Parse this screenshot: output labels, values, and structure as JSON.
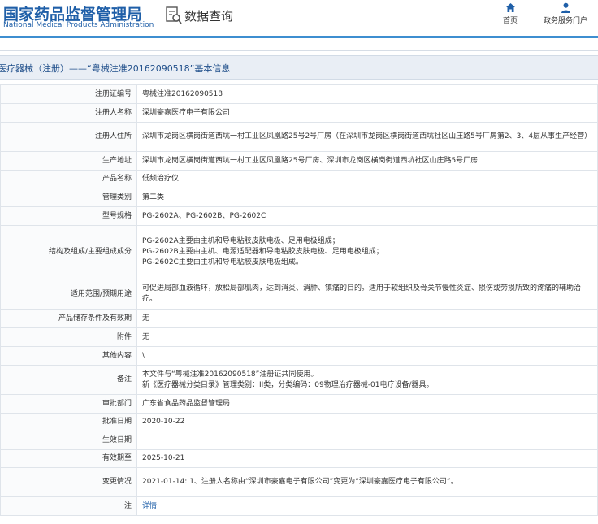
{
  "header": {
    "logo_cn": "国家药品监督管理局",
    "logo_en": "National Medical Products Administration",
    "search_label": "数据查询",
    "nav_home": "首页",
    "nav_portal": "政务服务门户"
  },
  "title": "医疗器械（注册）——“粤械注准20162090518”基本信息",
  "rows": [
    {
      "label": "注册证编号",
      "value": "粤械注准20162090518"
    },
    {
      "label": "注册人名称",
      "value": "深圳豪嘉医疗电子有限公司"
    },
    {
      "label": "注册人住所",
      "value": "深圳市龙岗区横岗街道西坑一村工业区凤凰路25号2号厂房（在深圳市龙岗区横岗街道西坑社区山庄路5号厂房第2、3、4层从事生产经营）"
    },
    {
      "label": "生产地址",
      "value": "深圳市龙岗区横岗街道西坑一村工业区凤凰路25号厂房、深圳市龙岗区横岗街道西坑社区山庄路5号厂房"
    },
    {
      "label": "产品名称",
      "value": "低频治疗仪"
    },
    {
      "label": "管理类别",
      "value": "第二类"
    },
    {
      "label": "型号规格",
      "value": "PG-2602A、PG-2602B、PG-2602C"
    },
    {
      "label": "结构及组成/主要组成成分",
      "lines": [
        "PG-2602A主要由主机和导电粘胶皮肤电极、足用电极组成；",
        "PG-2602B主要由主机、电源适配器和导电粘胶皮肤电极、足用电极组成；",
        "PG-2602C主要由主机和导电粘胶皮肤电极组成。"
      ]
    },
    {
      "label": "适用范围/预期用途",
      "value": "可促进局部血液循环，放松局部肌肉，达到消炎、消肿、镇痛的目的。适用于软组织及骨关节慢性炎症、损伤或劳损所致的疼痛的辅助治疗。"
    },
    {
      "label": "产品储存条件及有效期",
      "value": "无"
    },
    {
      "label": "附件",
      "value": "无"
    },
    {
      "label": "其他内容",
      "value": "\\"
    },
    {
      "label": "备注",
      "lines": [
        "本文件与“粤械注准20162090518”注册证共同使用。",
        "新《医疗器械分类目录》管理类别：II类，分类编码：09物理治疗器械-01电疗设备/器具。"
      ]
    },
    {
      "label": "审批部门",
      "value": "广东省食品药品监督管理局"
    },
    {
      "label": "批准日期",
      "value": "2020-10-22"
    },
    {
      "label": "生效日期",
      "value": ""
    },
    {
      "label": "有效期至",
      "value": "2025-10-21"
    },
    {
      "label": "变更情况",
      "value": "2021-01-14: 1、注册人名称由“深圳市豪嘉电子有限公司”变更为“深圳豪嘉医疗电子有限公司”。"
    },
    {
      "label": "注",
      "value": "详情",
      "link": true
    }
  ]
}
